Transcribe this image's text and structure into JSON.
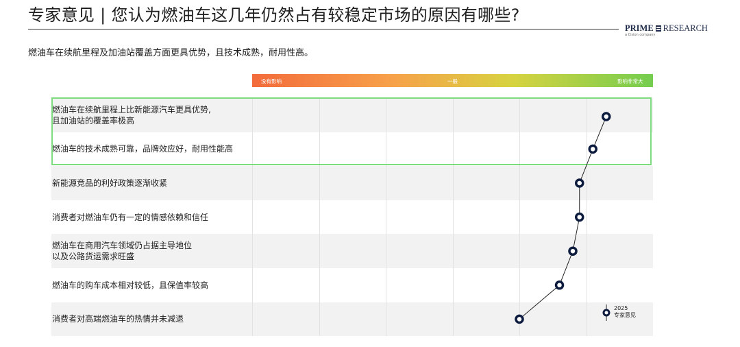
{
  "header": {
    "title": "专家意见 | 您认为燃油车这几年仍然占有较稳定市场的原因有哪些?",
    "logo_bold": "PRIME",
    "logo_rest": "RESEARCH",
    "logo_sub": "a Cision company"
  },
  "subtitle": "燃油车在续航里程及加油站覆盖方面更具优势，且技术成熟，耐用性高。",
  "colors": {
    "marker": "#0d1b3e",
    "highlight": "#7edb7e",
    "scale_left": "#f36b3b",
    "scale_right": "#74cd4f"
  },
  "chart_data": {
    "type": "scatter",
    "scale_labels": {
      "low": "没有影响",
      "mid": "一般",
      "high": "影响非常大"
    },
    "xlim": [
      0,
      6
    ],
    "rows": [
      {
        "line1": "燃油车在续航里程上比新能源汽车更具优势,",
        "line2": "且加油站的覆盖率极高",
        "value": 5.3
      },
      {
        "line1": "燃油车的技术成熟可靠，品牌效应好，耐用性能高",
        "line2": "",
        "value": 5.1
      },
      {
        "line1": "新能源竞品的利好政策逐渐收紧",
        "line2": "",
        "value": 4.9
      },
      {
        "line1": "消费者对燃油车仍有一定的情感依赖和信任",
        "line2": "",
        "value": 4.9
      },
      {
        "line1": "燃油车在商用汽车领域仍占据主导地位",
        "line2": "以及公路货运需求旺盛",
        "value": 4.8
      },
      {
        "line1": "燃油车的购车成本相对较低，且保值率较高",
        "line2": "",
        "value": 4.6
      },
      {
        "line1": "消费者对高端燃油车的热情并未减退",
        "line2": "",
        "value": 4.0
      }
    ],
    "highlighted_rows": [
      0,
      1
    ],
    "legend": {
      "year": "2025",
      "label": "专家意见"
    }
  }
}
